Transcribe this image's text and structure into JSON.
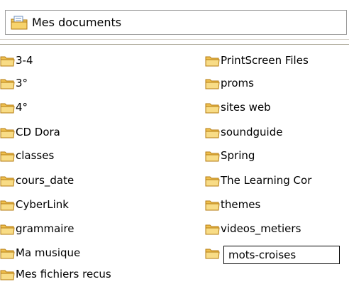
{
  "address_bar": {
    "icon": "my-documents-folder-icon",
    "label": "Mes documents"
  },
  "colors": {
    "folder_fill": "#f5d97a",
    "folder_edge": "#c28a1a",
    "rename_border": "#000000"
  },
  "folders_col1": [
    {
      "label": "3-4"
    },
    {
      "label": "3°"
    },
    {
      "label": "4°"
    },
    {
      "label": "CD Dora"
    },
    {
      "label": "classes"
    },
    {
      "label": "cours_date"
    },
    {
      "label": "CyberLink"
    },
    {
      "label": "grammaire"
    },
    {
      "label": "Ma musique"
    },
    {
      "label": "Mes fichiers recus"
    }
  ],
  "folders_col2": [
    {
      "label": "PrintScreen Files"
    },
    {
      "label": "proms"
    },
    {
      "label": "sites web"
    },
    {
      "label": "soundguide"
    },
    {
      "label": "Spring"
    },
    {
      "label": "The Learning Cor"
    },
    {
      "label": "themes"
    },
    {
      "label": "videos_metiers"
    },
    {
      "label": "mots-croises",
      "renaming": true
    }
  ]
}
